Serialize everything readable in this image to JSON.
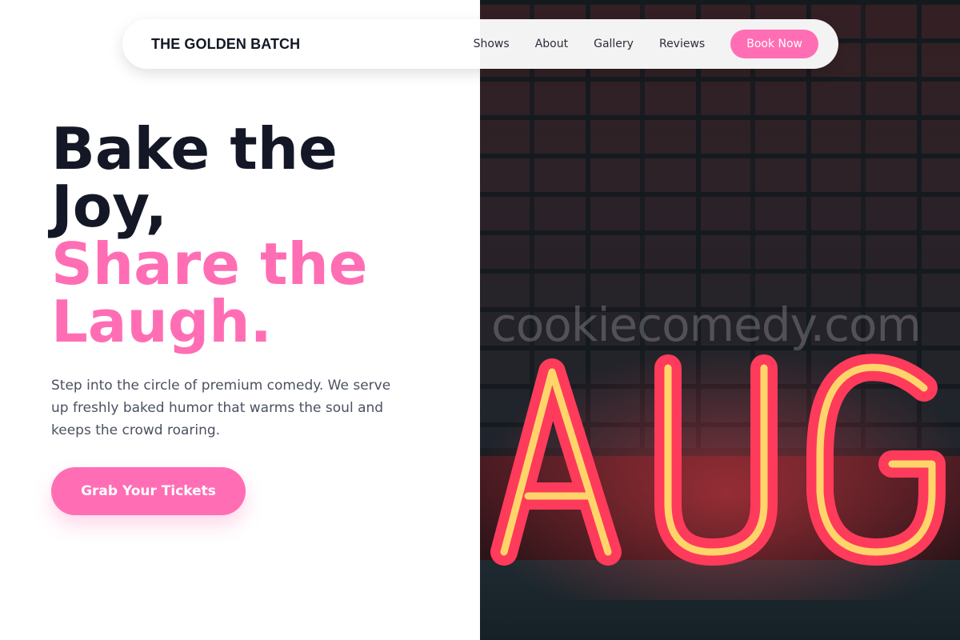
{
  "nav": {
    "brand": "THE GOLDEN BATCH",
    "links": [
      "Shows",
      "About",
      "Gallery",
      "Reviews"
    ],
    "cta": "Book Now"
  },
  "hero": {
    "title_line1": "Bake the",
    "title_line2": "Joy,",
    "title_line3": "Share the",
    "title_line4": "Laugh.",
    "lead": "Step into the circle of premium comedy. We serve up freshly baked humor that warms the soul and keeps the crowd roaring.",
    "cta": "Grab Your Tickets"
  },
  "photo": {
    "watermark": "cookiecomedy.com",
    "sign_text": "AUG"
  },
  "colors": {
    "accent": "#ff6eb4",
    "heading": "#141826",
    "body_text": "#4b5160"
  }
}
